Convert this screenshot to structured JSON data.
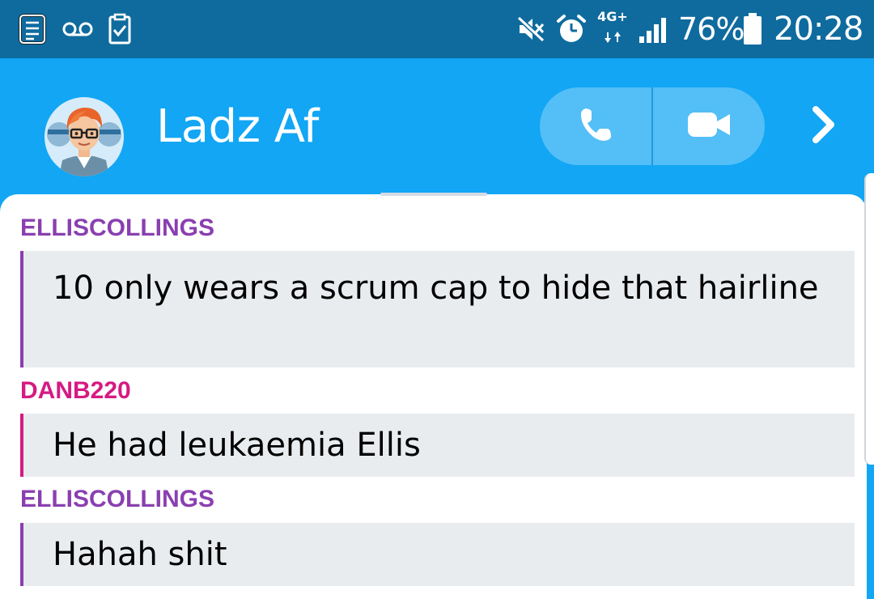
{
  "status_bar": {
    "left_icons": [
      "notes-icon",
      "voicemail-icon",
      "clipboard-check-icon"
    ],
    "right_icons": [
      "mute-icon",
      "alarm-icon",
      "signal-icon",
      "battery-icon"
    ],
    "network_label": "4G+",
    "battery_percent": "76%",
    "time": "20:28"
  },
  "header": {
    "title": "Ladz Af",
    "avatar": "bitmoji-avatar",
    "voice_call_icon": "phone-icon",
    "video_call_icon": "video-camera-icon",
    "details_icon": "chevron-right-icon"
  },
  "messages": [
    {
      "sender": "ELLISCOLLINGS",
      "sender_color": "#8a3fb0",
      "text": "10 only wears a scrum cap to hide that hairline"
    },
    {
      "sender": "DANB220",
      "sender_color": "#d61a82",
      "text": "He had leukaemia Ellis"
    },
    {
      "sender": "ELLISCOLLINGS",
      "sender_color": "#8a3fb0",
      "text": "Hahah shit"
    }
  ],
  "colors": {
    "status_bar_bg": "#0f6b9e",
    "header_bg": "#12a6f4",
    "bubble_bg": "#e9ecef",
    "ellis_purple": "#8a3fb0",
    "dan_pink": "#d61a82"
  }
}
